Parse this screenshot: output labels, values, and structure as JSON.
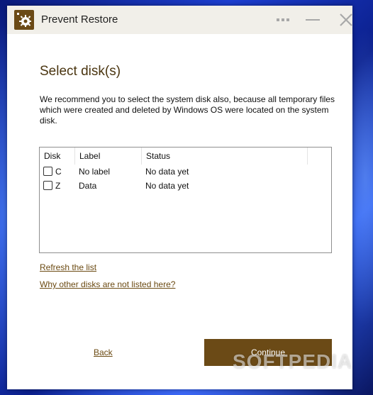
{
  "window": {
    "title": "Prevent Restore"
  },
  "page": {
    "heading": "Select disk(s)",
    "description": "We recommend you to select the system disk also, because all temporary files which were created and deleted by Windows OS were located on the system disk."
  },
  "disk_list": {
    "columns": [
      "Disk",
      "Label",
      "Status"
    ],
    "rows": [
      {
        "disk": "C",
        "label": "No label",
        "status": "No data yet",
        "checked": false
      },
      {
        "disk": "Z",
        "label": "Data",
        "status": "No data yet",
        "checked": false
      }
    ]
  },
  "links": {
    "refresh": "Refresh the list",
    "why": "Why other disks are not listed here?"
  },
  "footer": {
    "back_label": "Back",
    "continue_label": "Continue"
  },
  "watermark": "SOFTPEDIA",
  "colors": {
    "accent": "#6b4a16",
    "heading": "#4a3510",
    "link": "#6b4a12",
    "titlebar": "#f1efe9"
  },
  "icons": {
    "app": "gear-icon",
    "menu": "more-icon",
    "minimize": "minimize-icon",
    "close": "close-icon"
  }
}
